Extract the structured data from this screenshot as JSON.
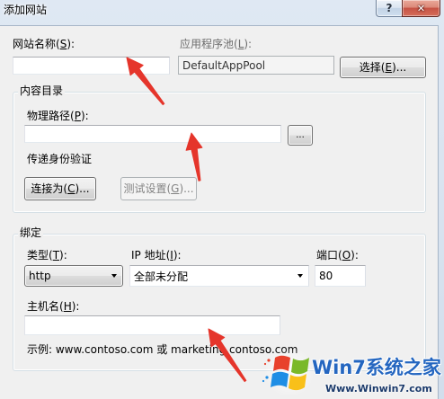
{
  "window": {
    "title": "添加网站",
    "help_button": {
      "icon": "help-icon",
      "glyph": "?"
    },
    "close_button": {
      "icon": "close-icon",
      "glyph": "✕"
    }
  },
  "site": {
    "name_label": "网站名称(S):",
    "name_value": "",
    "app_pool_label": "应用程序池(L):",
    "app_pool_value": "DefaultAppPool",
    "select_button": "选择(E)..."
  },
  "content_directory": {
    "group_title": "内容目录",
    "physical_path_label": "物理路径(P):",
    "physical_path_value": "",
    "browse_button": "...",
    "pass_through_label": "传递身份验证",
    "connect_as_button": "连接为(C)...",
    "test_settings_button": "测试设置(G)...",
    "test_settings_enabled": false
  },
  "binding": {
    "group_title": "绑定",
    "type_label": "类型(T):",
    "type_value": "http",
    "ip_label": "IP 地址(I):",
    "ip_value": "全部未分配",
    "port_label": "端口(O):",
    "port_value": "80",
    "host_label": "主机名(H):",
    "host_value": "",
    "example_text": "示例: www.contoso.com 或 marketing.contoso.com"
  },
  "watermark": {
    "logo_icon": "windows-flag-logo",
    "brand": "Win7系统之家",
    "url": "Www.Winwin7.com"
  },
  "colors": {
    "annotation_arrow": "#e5352b",
    "close_button": "#c65344",
    "disabled_text": "#838383",
    "watermark_brand": "#2466c0",
    "watermark_url": "#1b3a6b"
  }
}
